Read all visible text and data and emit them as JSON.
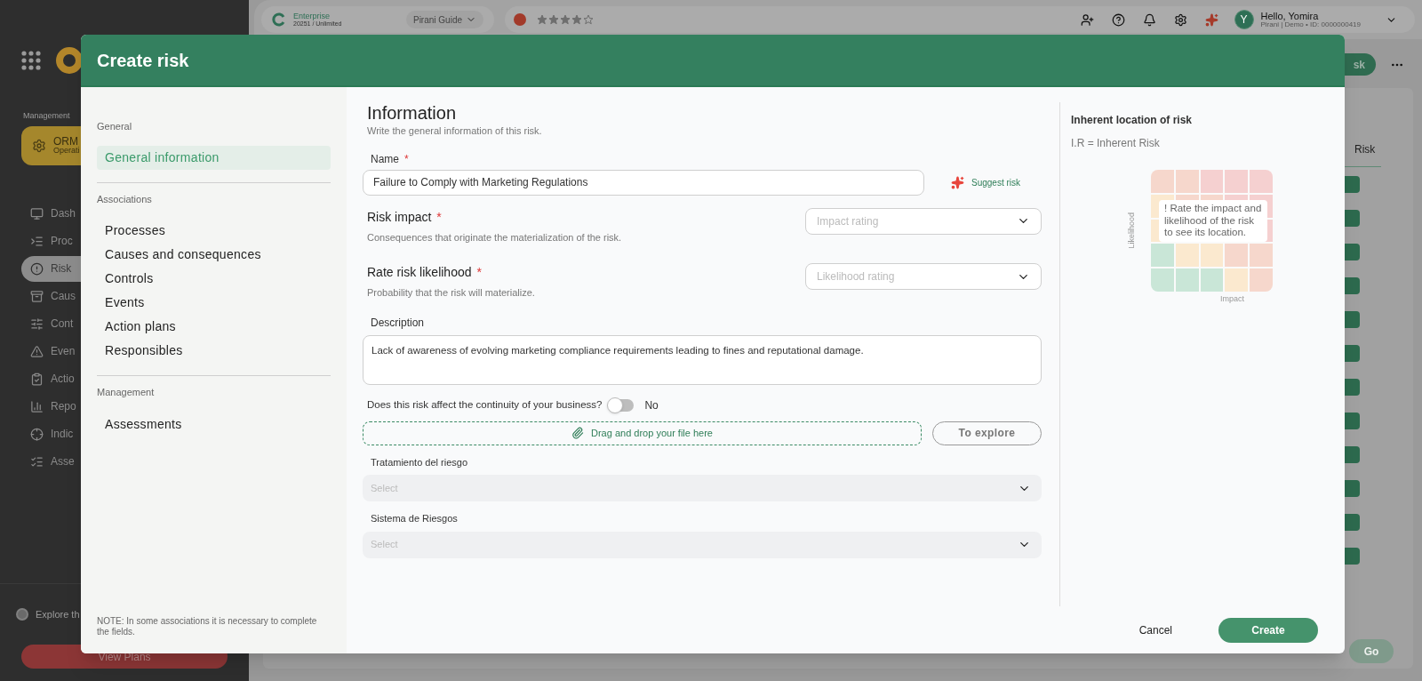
{
  "topbar": {
    "plan": {
      "name": "Enterprise",
      "detail": "20251 / Unlimited"
    },
    "guide": "Pirani Guide",
    "rating": {
      "stars": 4
    },
    "user": {
      "initial": "Y",
      "greeting": "Hello, Yomira",
      "detail": "Pirani | Demo • ID: 0000000419"
    }
  },
  "sidebar": {
    "section": "Management",
    "module": {
      "name": "ORM",
      "subtitle": "Operati"
    },
    "items": [
      {
        "label": "Dash",
        "selected": false
      },
      {
        "label": "Proc",
        "selected": false
      },
      {
        "label": "Risk",
        "selected": true
      },
      {
        "label": "Caus",
        "selected": false
      },
      {
        "label": "Cont",
        "selected": false
      },
      {
        "label": "Even",
        "selected": false
      },
      {
        "label": "Actio",
        "selected": false
      },
      {
        "label": "Repo",
        "selected": false
      },
      {
        "label": "Indic",
        "selected": false
      },
      {
        "label": "Asse",
        "selected": false
      }
    ],
    "explore": "Explore th",
    "plans_button": "View Plans"
  },
  "background": {
    "primary_button": "sk",
    "column_header": "Risk",
    "go_button": "Go"
  },
  "modal": {
    "title": "Create risk",
    "nav": [
      {
        "heading": "General",
        "items": [
          {
            "label": "General information",
            "selected": true
          }
        ]
      },
      {
        "heading": "Associations",
        "items": [
          {
            "label": "Processes",
            "selected": false
          },
          {
            "label": "Causes and consequences",
            "selected": false
          },
          {
            "label": "Controls",
            "selected": false
          },
          {
            "label": "Events",
            "selected": false
          },
          {
            "label": "Action plans",
            "selected": false
          },
          {
            "label": "Responsibles",
            "selected": false
          }
        ]
      },
      {
        "heading": "Management",
        "items": [
          {
            "label": "Assessments",
            "selected": false
          }
        ]
      }
    ],
    "note": "NOTE: In some associations it is necessary to complete the fields.",
    "form": {
      "heading": "Information",
      "subheading": "Write the general information of this risk.",
      "name": {
        "label": "Name",
        "required": "*",
        "value": "Failure to Comply with Marketing Regulations"
      },
      "suggest": "Suggest risk",
      "ratings": [
        {
          "title": "Risk impact",
          "required": "*",
          "hint": "Consequences that originate the materialization of the risk.",
          "placeholder": "Impact rating"
        },
        {
          "title": "Rate risk likelihood",
          "required": "*",
          "hint": "Probability that the risk will materialize.",
          "placeholder": "Likelihood rating"
        }
      ],
      "description": {
        "label": "Description",
        "value": "Lack of awareness of evolving marketing compliance requirements leading to fines and reputational damage."
      },
      "continuity": {
        "question": "Does this risk affect the continuity of your business?",
        "on": false,
        "value_label": "No"
      },
      "upload": "Drag and drop your file here",
      "explore_button": "To explore",
      "selects": [
        {
          "label": "Tratamiento del riesgo",
          "placeholder": "Select"
        },
        {
          "label": "Sistema de Riesgos",
          "placeholder": "Select"
        }
      ]
    },
    "panel": {
      "title": "Inherent location of risk",
      "legend": "I.R = Inherent Risk",
      "tooltip": "! Rate the impact and likelihood of the risk to see its location.",
      "y_label": "Likelihood",
      "x_label": "Impact"
    },
    "cancel": "Cancel",
    "create": "Create"
  }
}
